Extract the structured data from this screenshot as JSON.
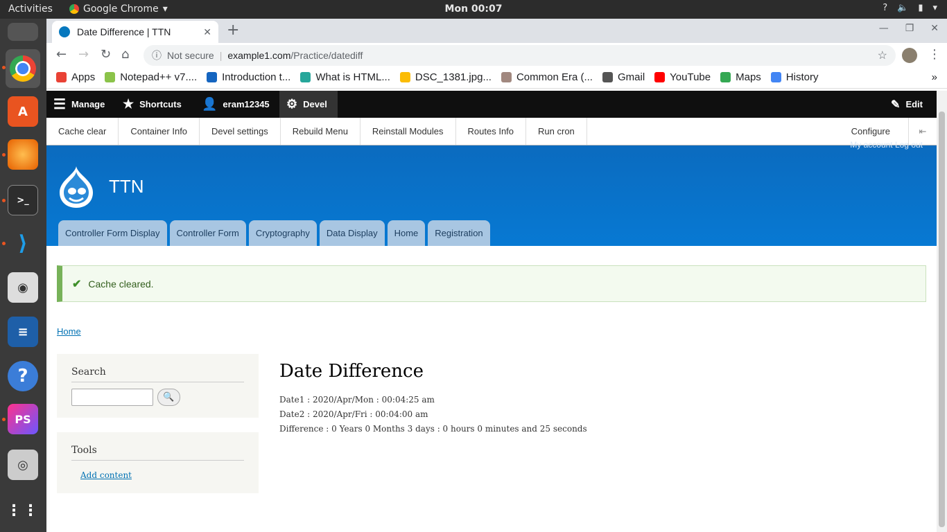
{
  "os": {
    "activities": "Activities",
    "app_name": "Google Chrome",
    "clock": "Mon 00:07"
  },
  "browser": {
    "tab_title": "Date Difference | TTN",
    "security_label": "Not secure",
    "url_host": "example1.com",
    "url_path": "/Practice/datediff",
    "bookmarks": [
      {
        "label": "Apps",
        "color": "#e94235"
      },
      {
        "label": "Notepad++ v7....",
        "color": "#8bc34a"
      },
      {
        "label": "Introduction t...",
        "color": "#1565c0"
      },
      {
        "label": "What is HTML...",
        "color": "#26a69a"
      },
      {
        "label": "DSC_1381.jpg...",
        "color": "#fbbc05"
      },
      {
        "label": "Common Era (...",
        "color": "#a1887f"
      },
      {
        "label": "Gmail",
        "color": "#555555"
      },
      {
        "label": "YouTube",
        "color": "#ff0000"
      },
      {
        "label": "Maps",
        "color": "#34a853"
      },
      {
        "label": "History",
        "color": "#4285f4"
      }
    ],
    "bookmarks_more": "»"
  },
  "admin": {
    "toolbar": {
      "manage": "Manage",
      "shortcuts": "Shortcuts",
      "user": "eram12345",
      "devel": "Devel",
      "edit": "Edit"
    },
    "tray": {
      "items": [
        "Cache clear",
        "Container Info",
        "Devel settings",
        "Rebuild Menu",
        "Reinstall Modules",
        "Routes Info",
        "Run cron"
      ],
      "configure": "Configure"
    }
  },
  "site": {
    "name": "TTN",
    "secondary_menu": "My account    Log out",
    "primary_tabs": [
      "Controller Form Display",
      "Controller Form",
      "Cryptography",
      "Data Display",
      "Home",
      "Registration"
    ],
    "status_message": "Cache cleared.",
    "breadcrumb": "Home",
    "search_block": {
      "title": "Search"
    },
    "tools_block": {
      "title": "Tools",
      "link": "Add content"
    }
  },
  "main": {
    "title": "Date Difference",
    "lines": [
      "Date1 : 2020/Apr/Mon : 00:04:25 am",
      "Date2 : 2020/Apr/Fri : 00:04:00 am",
      "Difference : 0 Years 0 Months 3 days : 0 hours 0 minutes and 25 seconds"
    ]
  },
  "colors": {
    "admin_bar": "#0f0f0f",
    "header_blue": "#0779d3",
    "status_green": "#77b259",
    "link_blue": "#0071b3"
  }
}
